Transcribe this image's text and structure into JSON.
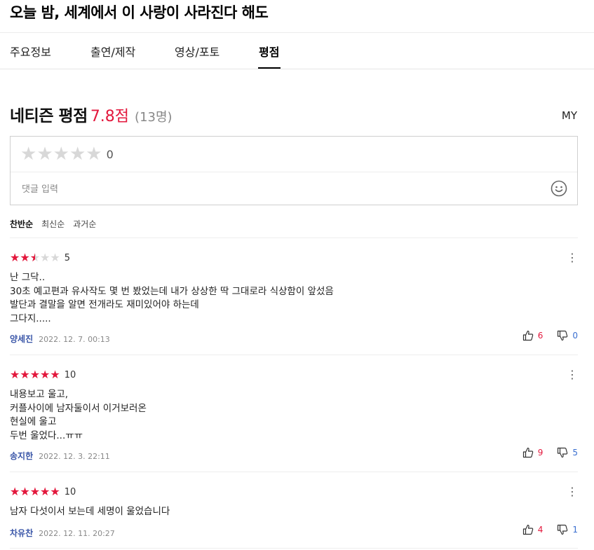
{
  "title": "오늘 밤, 세계에서 이 사랑이 사라진다 해도",
  "tabs": [
    {
      "label": "주요정보"
    },
    {
      "label": "출연/제작"
    },
    {
      "label": "영상/포토"
    },
    {
      "label": "평점"
    }
  ],
  "rating": {
    "label": "네티즌 평점",
    "score": "7.8점",
    "count": "(13명)",
    "my": "MY"
  },
  "input": {
    "stars_value": "0",
    "placeholder": "댓글 입력"
  },
  "sorts": [
    {
      "label": "찬반순"
    },
    {
      "label": "최신순"
    },
    {
      "label": "과거순"
    }
  ],
  "reviews": [
    {
      "rating": "5",
      "text": "난 그닥..\n30초 예고편과 유사작도 몇 번 봤었는데 내가 상상한 딱 그대로라 식상함이 앞섰음\n발단과 결말을 알면 전개라도 재미있어야 하는데\n그다지.....",
      "user": "양세진",
      "date": "2022. 12. 7. 00:13",
      "up": "6",
      "down": "0"
    },
    {
      "rating": "10",
      "text": "내용보고 울고,\n커플사이에 남자둘이서 이거보러온\n현실에 울고\n두번 울었다...ㅠㅠ",
      "user": "송지한",
      "date": "2022. 12. 3. 22:11",
      "up": "9",
      "down": "5"
    },
    {
      "rating": "10",
      "text": "남자 다섯이서 보는데 세명이 울었습니다",
      "user": "차유찬",
      "date": "2022. 12. 11. 20:27",
      "up": "4",
      "down": "1"
    }
  ],
  "colors": {
    "accent": "#e3173c",
    "user": "#3a56a8",
    "down": "#3a6fd0"
  }
}
